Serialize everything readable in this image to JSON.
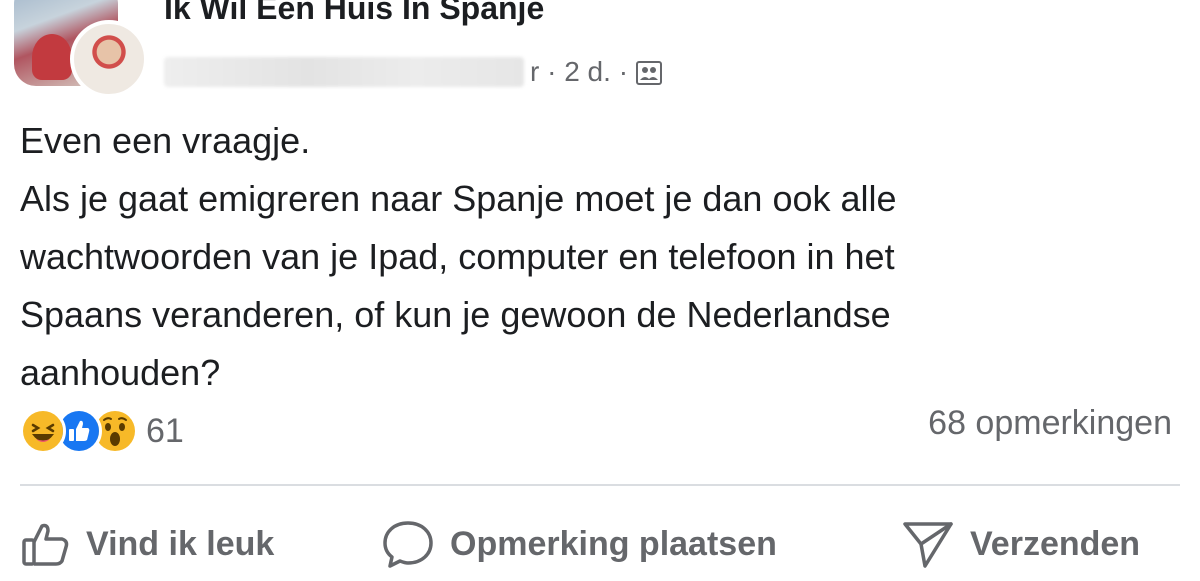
{
  "post": {
    "group_name": "Ik Wil Een Huis In Spanje",
    "meta_suffix": "r · 2 d. ·",
    "text_lines": [
      "Even een vraagje.",
      "Als je gaat emigreren naar Spanje moet je dan ook alle",
      "wachtwoorden van je Ipad, computer en telefoon in het",
      "Spaans veranderen, of kun je gewoon de Nederlandse",
      "aanhouden?"
    ],
    "icons": {
      "more": "more-horizontal-icon",
      "audience": "group-members-icon"
    }
  },
  "reactions": {
    "types": [
      "haha",
      "like",
      "wow"
    ],
    "count": "61",
    "comments": "68 opmerkingen"
  },
  "actions": {
    "like_label": "Vind ik leuk",
    "comment_label": "Opmerking plaatsen",
    "share_label": "Verzenden"
  },
  "colors": {
    "text": "#1c1e21",
    "secondary": "#65676b",
    "like_blue": "#1877f2",
    "reaction_yellow": "#f7b928",
    "divider": "#dadde1"
  }
}
